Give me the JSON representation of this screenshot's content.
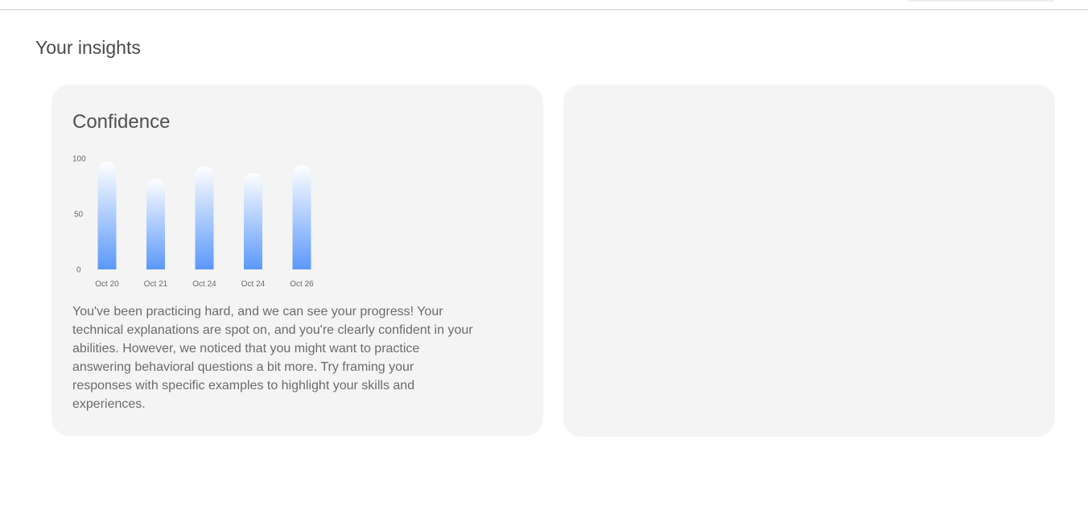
{
  "page": {
    "section_title": "Your insights"
  },
  "confidence_card": {
    "title": "Confidence",
    "summary": "You've been practicing hard, and we can see your progress! Your technical explanations are spot on, and you're clearly confident in your abilities. However, we noticed that you might want to practice answering behavioral questions a bit more. Try framing your responses with specific examples to highlight your skills and experiences."
  },
  "colors": {
    "bar_top": "#ffffff",
    "bar_bottom": "#5b98fb",
    "card_background": "#f4f4f4"
  },
  "chart_data": {
    "type": "bar",
    "categories": [
      "Oct 20",
      "Oct 21",
      "Oct 24",
      "Oct 24",
      "Oct 26"
    ],
    "values": [
      97,
      82,
      93,
      87,
      94
    ],
    "ylim": [
      0,
      100
    ],
    "yticks": [
      "0",
      "50",
      "100"
    ],
    "title": "",
    "xlabel": "",
    "ylabel": "",
    "grid": false,
    "legend": "none"
  }
}
